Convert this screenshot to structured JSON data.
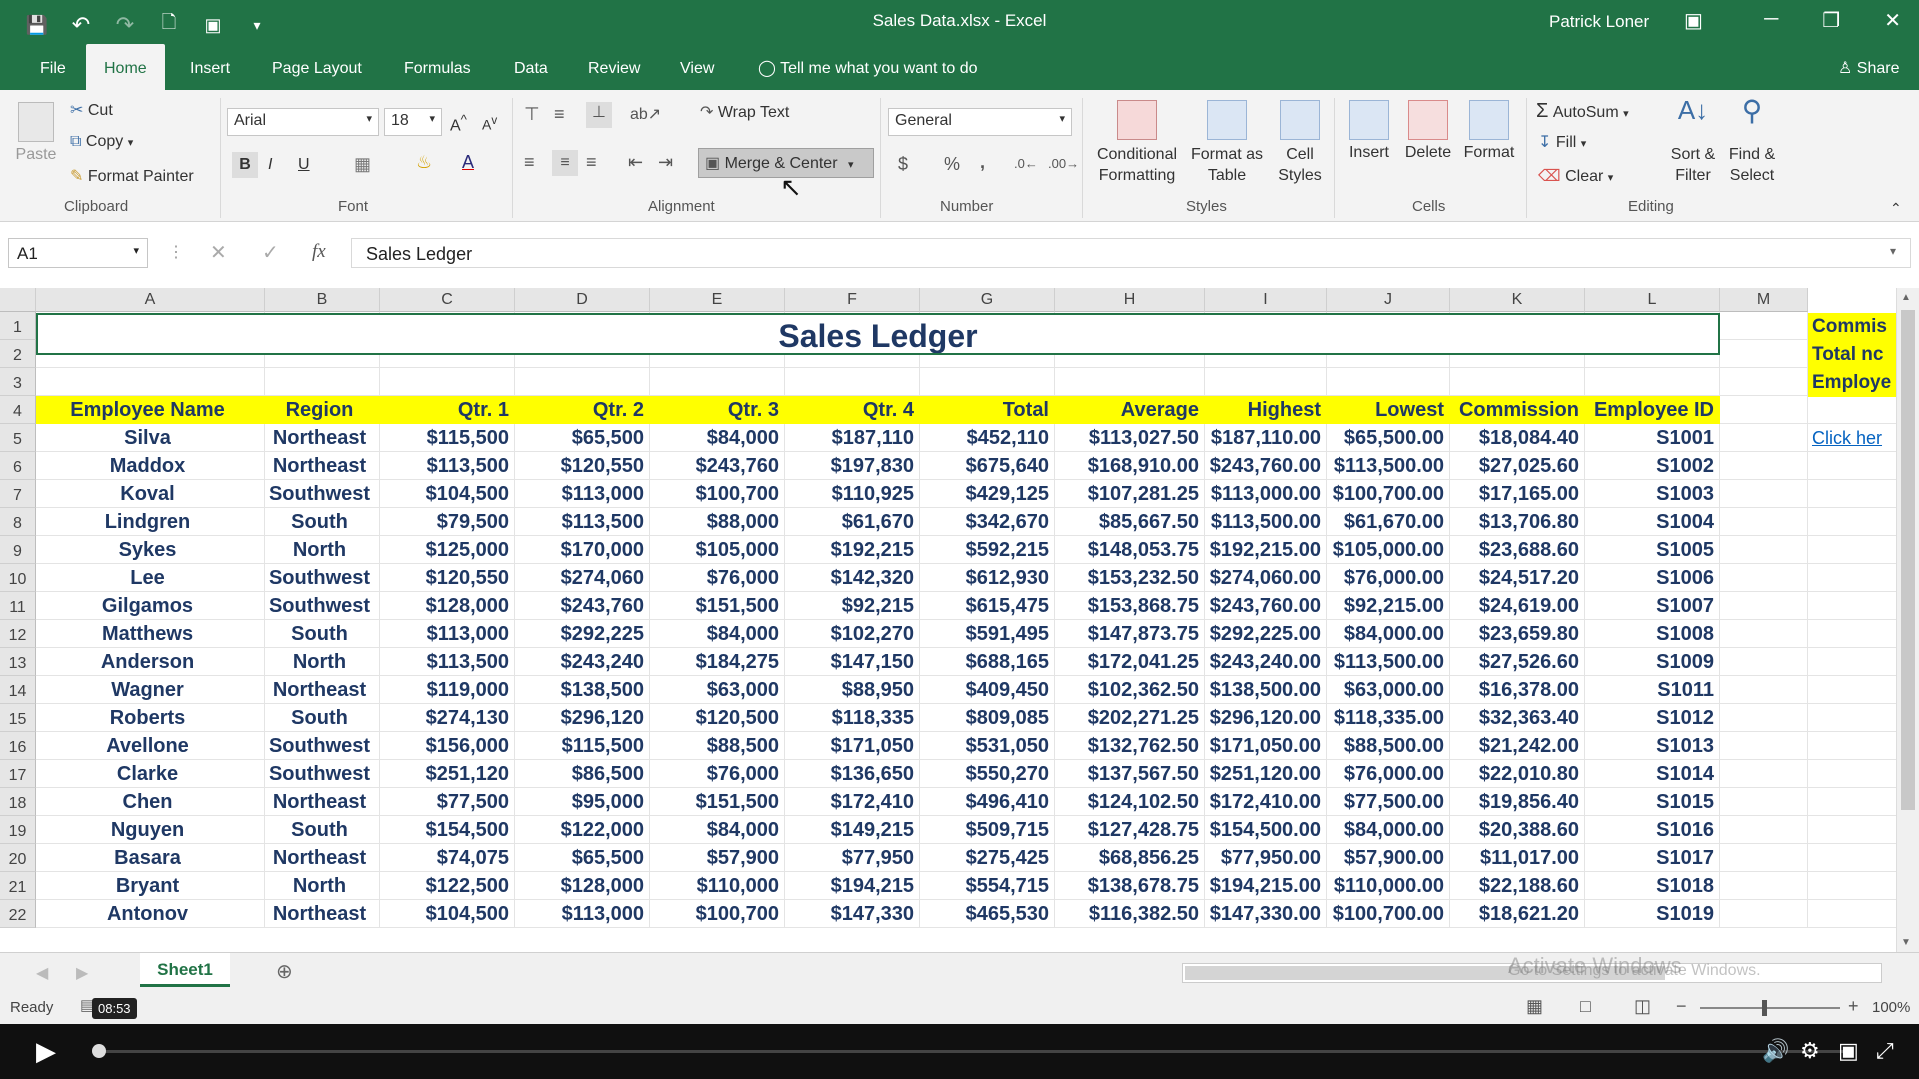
{
  "window": {
    "title": "Sales Data.xlsx  -  Excel",
    "user": "Patrick Loner",
    "minimize": "─",
    "restore": "❐",
    "close": "✕",
    "ribbon_options": "▣"
  },
  "qat": {
    "save": "💾",
    "undo": "↶",
    "redo": "↷",
    "preview": "🗋",
    "extra": "▣",
    "customize": "▾"
  },
  "tabs": [
    "File",
    "Home",
    "Insert",
    "Page Layout",
    "Formulas",
    "Data",
    "Review",
    "View"
  ],
  "tell_me": "Tell me what you want to do",
  "share": "Share",
  "ribbon": {
    "clipboard": {
      "paste": "Paste",
      "cut": "Cut",
      "copy": "Copy",
      "format_painter": "Format Painter",
      "label": "Clipboard"
    },
    "font": {
      "name": "Arial",
      "size": "18",
      "bold": "B",
      "italic": "I",
      "underline": "U",
      "label": "Font"
    },
    "alignment": {
      "wrap": "Wrap Text",
      "merge": "Merge & Center",
      "label": "Alignment"
    },
    "number": {
      "format": "General",
      "currency": "$",
      "percent": "%",
      "comma": ",",
      "label": "Number"
    },
    "styles": {
      "conditional": "Conditional Formatting",
      "format_table": "Format as Table",
      "cell_styles": "Cell Styles",
      "label": "Styles"
    },
    "cells": {
      "insert": "Insert",
      "delete": "Delete",
      "format": "Format",
      "label": "Cells"
    },
    "editing": {
      "autosum": "AutoSum",
      "fill": "Fill",
      "clear": "Clear",
      "sort": "Sort & Filter",
      "find": "Find & Select",
      "label": "Editing"
    }
  },
  "formula_bar": {
    "name_box": "A1",
    "fx": "fx",
    "content": "Sales Ledger"
  },
  "sheet": {
    "columns": [
      "A",
      "B",
      "C",
      "D",
      "E",
      "F",
      "G",
      "H",
      "I",
      "J",
      "K",
      "L",
      "M"
    ],
    "title": "Sales Ledger",
    "headers": [
      "Employee Name",
      "Region",
      "Qtr. 1",
      "Qtr. 2",
      "Qtr. 3",
      "Qtr. 4",
      "Total",
      "Average",
      "Highest",
      "Lowest",
      "Commission",
      "Employee ID"
    ],
    "rows": [
      [
        "Silva",
        "Northeast",
        "$115,500",
        "$65,500",
        "$84,000",
        "$187,110",
        "$452,110",
        "$113,027.50",
        "$187,110.00",
        "$65,500.00",
        "$18,084.40",
        "S1001"
      ],
      [
        "Maddox",
        "Northeast",
        "$113,500",
        "$120,550",
        "$243,760",
        "$197,830",
        "$675,640",
        "$168,910.00",
        "$243,760.00",
        "$113,500.00",
        "$27,025.60",
        "S1002"
      ],
      [
        "Koval",
        "Southwest",
        "$104,500",
        "$113,000",
        "$100,700",
        "$110,925",
        "$429,125",
        "$107,281.25",
        "$113,000.00",
        "$100,700.00",
        "$17,165.00",
        "S1003"
      ],
      [
        "Lindgren",
        "South",
        "$79,500",
        "$113,500",
        "$88,000",
        "$61,670",
        "$342,670",
        "$85,667.50",
        "$113,500.00",
        "$61,670.00",
        "$13,706.80",
        "S1004"
      ],
      [
        "Sykes",
        "North",
        "$125,000",
        "$170,000",
        "$105,000",
        "$192,215",
        "$592,215",
        "$148,053.75",
        "$192,215.00",
        "$105,000.00",
        "$23,688.60",
        "S1005"
      ],
      [
        "Lee",
        "Southwest",
        "$120,550",
        "$274,060",
        "$76,000",
        "$142,320",
        "$612,930",
        "$153,232.50",
        "$274,060.00",
        "$76,000.00",
        "$24,517.20",
        "S1006"
      ],
      [
        "Gilgamos",
        "Southwest",
        "$128,000",
        "$243,760",
        "$151,500",
        "$92,215",
        "$615,475",
        "$153,868.75",
        "$243,760.00",
        "$92,215.00",
        "$24,619.00",
        "S1007"
      ],
      [
        "Matthews",
        "South",
        "$113,000",
        "$292,225",
        "$84,000",
        "$102,270",
        "$591,495",
        "$147,873.75",
        "$292,225.00",
        "$84,000.00",
        "$23,659.80",
        "S1008"
      ],
      [
        "Anderson",
        "North",
        "$113,500",
        "$243,240",
        "$184,275",
        "$147,150",
        "$688,165",
        "$172,041.25",
        "$243,240.00",
        "$113,500.00",
        "$27,526.60",
        "S1009"
      ],
      [
        "Wagner",
        "Northeast",
        "$119,000",
        "$138,500",
        "$63,000",
        "$88,950",
        "$409,450",
        "$102,362.50",
        "$138,500.00",
        "$63,000.00",
        "$16,378.00",
        "S1011"
      ],
      [
        "Roberts",
        "South",
        "$274,130",
        "$296,120",
        "$120,500",
        "$118,335",
        "$809,085",
        "$202,271.25",
        "$296,120.00",
        "$118,335.00",
        "$32,363.40",
        "S1012"
      ],
      [
        "Avellone",
        "Southwest",
        "$156,000",
        "$115,500",
        "$88,500",
        "$171,050",
        "$531,050",
        "$132,762.50",
        "$171,050.00",
        "$88,500.00",
        "$21,242.00",
        "S1013"
      ],
      [
        "Clarke",
        "Southwest",
        "$251,120",
        "$86,500",
        "$76,000",
        "$136,650",
        "$550,270",
        "$137,567.50",
        "$251,120.00",
        "$76,000.00",
        "$22,010.80",
        "S1014"
      ],
      [
        "Chen",
        "Northeast",
        "$77,500",
        "$95,000",
        "$151,500",
        "$172,410",
        "$496,410",
        "$124,102.50",
        "$172,410.00",
        "$77,500.00",
        "$19,856.40",
        "S1015"
      ],
      [
        "Nguyen",
        "South",
        "$154,500",
        "$122,000",
        "$84,000",
        "$149,215",
        "$509,715",
        "$127,428.75",
        "$154,500.00",
        "$84,000.00",
        "$20,388.60",
        "S1016"
      ],
      [
        "Basara",
        "Northeast",
        "$74,075",
        "$65,500",
        "$57,900",
        "$77,950",
        "$275,425",
        "$68,856.25",
        "$77,950.00",
        "$57,900.00",
        "$11,017.00",
        "S1017"
      ],
      [
        "Bryant",
        "North",
        "$122,500",
        "$128,000",
        "$110,000",
        "$194,215",
        "$554,715",
        "$138,678.75",
        "$194,215.00",
        "$110,000.00",
        "$22,188.60",
        "S1018"
      ],
      [
        "Antonov",
        "Northeast",
        "$104,500",
        "$113,000",
        "$100,700",
        "$147,330",
        "$465,530",
        "$116,382.50",
        "$147,330.00",
        "$100,700.00",
        "$18,621.20",
        "S1019"
      ]
    ],
    "side_note": [
      "Commis",
      "Total nc",
      "Employe"
    ],
    "link": "Click her",
    "row_numbers": [
      "1",
      "2",
      "3",
      "4",
      "5",
      "6",
      "7",
      "8",
      "9",
      "10",
      "11",
      "12",
      "13",
      "14",
      "15",
      "16",
      "17",
      "18",
      "19",
      "20",
      "21",
      "22"
    ]
  },
  "sheet_tab": "Sheet1",
  "add_sheet": "⊕",
  "status": {
    "ready": "Ready",
    "zoom": "100%",
    "time": "08:53"
  },
  "watermark": {
    "line1": "Activate Windows",
    "line2": "Go to Settings to activate Windows."
  },
  "colors": {
    "excel_green": "#217346",
    "header_yellow": "#ffff00",
    "text_navy": "#1f3864"
  }
}
